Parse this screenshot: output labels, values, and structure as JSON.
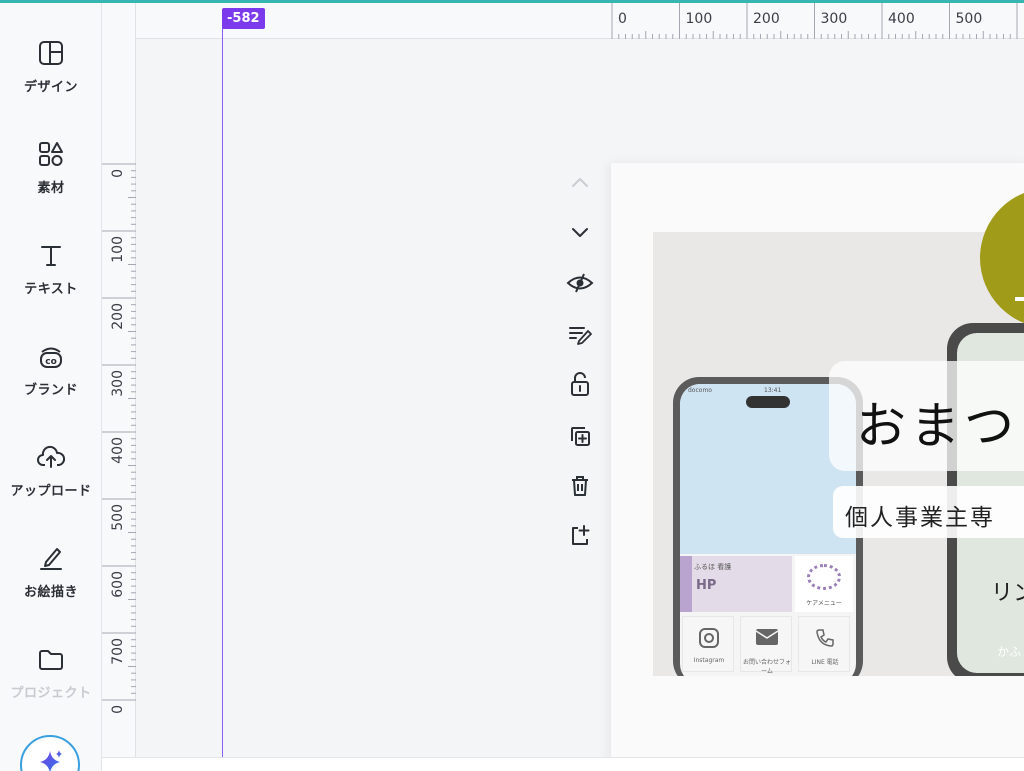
{
  "sidebar": {
    "items": [
      {
        "label": "デザイン",
        "icon": "layout-icon"
      },
      {
        "label": "素材",
        "icon": "shapes-icon"
      },
      {
        "label": "テキスト",
        "icon": "text-icon"
      },
      {
        "label": "ブランド",
        "icon": "brand-icon"
      },
      {
        "label": "アップロード",
        "icon": "cloud-upload-icon"
      },
      {
        "label": "お絵描き",
        "icon": "pen-icon"
      },
      {
        "label": "プロジェクト",
        "icon": "folder-icon"
      }
    ],
    "ai_button": "magic-sparkle-icon"
  },
  "guide": {
    "position_label": "-582",
    "color": "#7c3aed"
  },
  "toolbar": {
    "icons": [
      "chevron-up-icon",
      "chevron-down-icon",
      "eye-hidden-icon",
      "edit-notes-icon",
      "unlock-icon",
      "duplicate-icon",
      "trash-icon",
      "add-page-icon"
    ]
  },
  "design": {
    "title": "おまつ",
    "subtitle": "個人事業主専",
    "link": "リン",
    "bottom_caption": "かふ",
    "phone_status": "docomo",
    "phone_time": "13:41",
    "hp_title": "ふるほ 看護",
    "hp_label": "HP",
    "menu_label": "ケアメニュー",
    "app_instagram": "Instagram",
    "app_contact": "お問い合わせフォーム",
    "app_line": "LINE 電話",
    "accent_color": "#a09b18"
  },
  "chart_data": {
    "type": "table",
    "top_ruler": {
      "ticks": [
        0,
        100,
        200,
        300,
        400,
        500
      ]
    },
    "left_ruler": {
      "ticks": [
        0,
        100,
        200,
        300,
        400,
        500,
        600,
        700,
        0
      ]
    }
  }
}
